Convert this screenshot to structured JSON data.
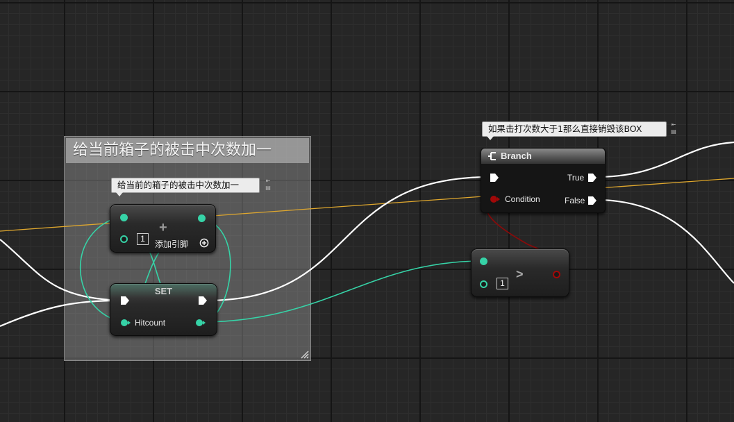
{
  "comment_box": {
    "title": "给当前箱子的被击中次数加一"
  },
  "bubbles": {
    "add": "给当前的箱子的被击中次数加一",
    "branch": "如果击打次数大于1那么直接销毁该BOX"
  },
  "add_node": {
    "symbol": "+",
    "value": "1",
    "add_pin_label": "添加引脚"
  },
  "set_node": {
    "title": "SET",
    "var_label": "Hitcount"
  },
  "compare_node": {
    "symbol": ">",
    "value": "1"
  },
  "branch_node": {
    "title": "Branch",
    "condition_label": "Condition",
    "true_label": "True",
    "false_label": "False"
  },
  "colors": {
    "exec_wire": "#ffffff",
    "int_wire": "#36d3a7",
    "bool_wire": "#8a0a0a",
    "object_wire": "#e0a82e",
    "grid_bg": "#262626"
  }
}
